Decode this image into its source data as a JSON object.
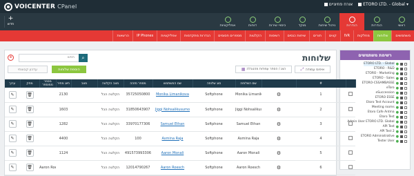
{
  "topbar": {
    "brand": "VOICENTER",
    "brand_suffix": "CPanel",
    "account": "ETORO LTD. - Global",
    "user": "אורח פוזיוניים"
  },
  "secbar": {
    "new_label": "חדש",
    "nav": [
      {
        "label": "ראשי",
        "icon": "home-icon"
      },
      {
        "label": "הגדרות",
        "icon": "settings-icon"
      },
      {
        "label": "הגדרות",
        "icon": "gear-icon"
      },
      {
        "label": "ניהול שיחות",
        "icon": "phone-icon"
      },
      {
        "label": "מוקד",
        "icon": "headset-icon"
      },
      {
        "label": "כיסויי שירות",
        "icon": "globe-icon"
      },
      {
        "label": "דוחות",
        "icon": "chart-icon"
      },
      {
        "label": "אפליקציות",
        "icon": "apps-icon"
      }
    ]
  },
  "tabs": [
    "משתמשים",
    "שלוחות",
    "מחלקות",
    "IVR",
    "קווים",
    "תורים",
    "שיחות כנסים",
    "רשימות",
    "הקלטות",
    "מספרים חסומים",
    "הגדרות מתקדמות",
    "אפליקציות",
    "IP Phones",
    "הרשאות"
  ],
  "sidebar": {
    "title": "רשימת משתמשים",
    "items": [
      "ETORO LTD. - Global",
      "ETORO - R&D",
      "ETORO - Marketing",
      "ETORO - Sales",
      "ETORO-CSSAMBASSE",
      "eToro",
      "eSuccession",
      "ETORO ESSE",
      "Etoro Test Account",
      "Meeting rooms",
      "Etoro Cafe Antma",
      "Etoro Test",
      "Admin User ETORO LTD. Global",
      "API Test",
      "API Test 2",
      "ETORO Administrative",
      "Tester User"
    ]
  },
  "main": {
    "title": "שלוחות",
    "search_label": "חפש",
    "add_label": "הוספת שלוחות",
    "edit_label": "עדכון קבוצתי",
    "reset_label": "איפוס עמודה",
    "cols_label": "הצג / הסתר עמודות מהטבלה"
  },
  "table": {
    "headers": [
      "",
      "#",
      "",
      "שם השלוחה",
      "סוג שלוחה",
      "שם המשתמש",
      "מספר מזהה",
      "מצב הקלטה",
      "מצב",
      "חיוג מחיר",
      "מספר ממוספר",
      "מחק",
      "ערוך"
    ],
    "rows": [
      {
        "num": "1",
        "name": "Monika Limanikova",
        "type": "Softphone",
        "user": "Monika Limanikova",
        "id": "35725050800",
        "rec": "הקלטה הכל",
        "state": "",
        "price": "2130",
        "mobile": ""
      },
      {
        "num": "2",
        "name": "Jiggi Nohsalikusumo",
        "type": "Softphone",
        "user": "Jiggi Nohsalikusumo",
        "id": "31850643907",
        "rec": "הקלטה הכל",
        "state": "",
        "price": "1603",
        "mobile": ""
      },
      {
        "num": "3",
        "name": "Samuel Ethan",
        "type": "Softphone",
        "user": "Samuel Ethan",
        "id": "33970177306",
        "rec": "הקלטה הכל",
        "state": "",
        "price": "1282",
        "mobile": ""
      },
      {
        "num": "4",
        "name": "Asmina Raja",
        "type": "Softphone",
        "user": "Asmina Raja",
        "id": "100",
        "rec": "הקלטה הכל",
        "state": "",
        "price": "4400",
        "mobile": ""
      },
      {
        "num": "5",
        "name": "Aaron Monali",
        "type": "Softphone",
        "user": "Aaron Monali",
        "id": "491573993306",
        "rec": "הקלטה הכל",
        "state": "",
        "price": "1124",
        "mobile": ""
      },
      {
        "num": "6",
        "name": "Aaron Roesch",
        "type": "Softphone",
        "user": "Aaron Roesch",
        "id": "12014790267",
        "rec": "הקלטה הכל",
        "state": "",
        "price": "",
        "mobile": "Aaron Roesch"
      }
    ]
  }
}
